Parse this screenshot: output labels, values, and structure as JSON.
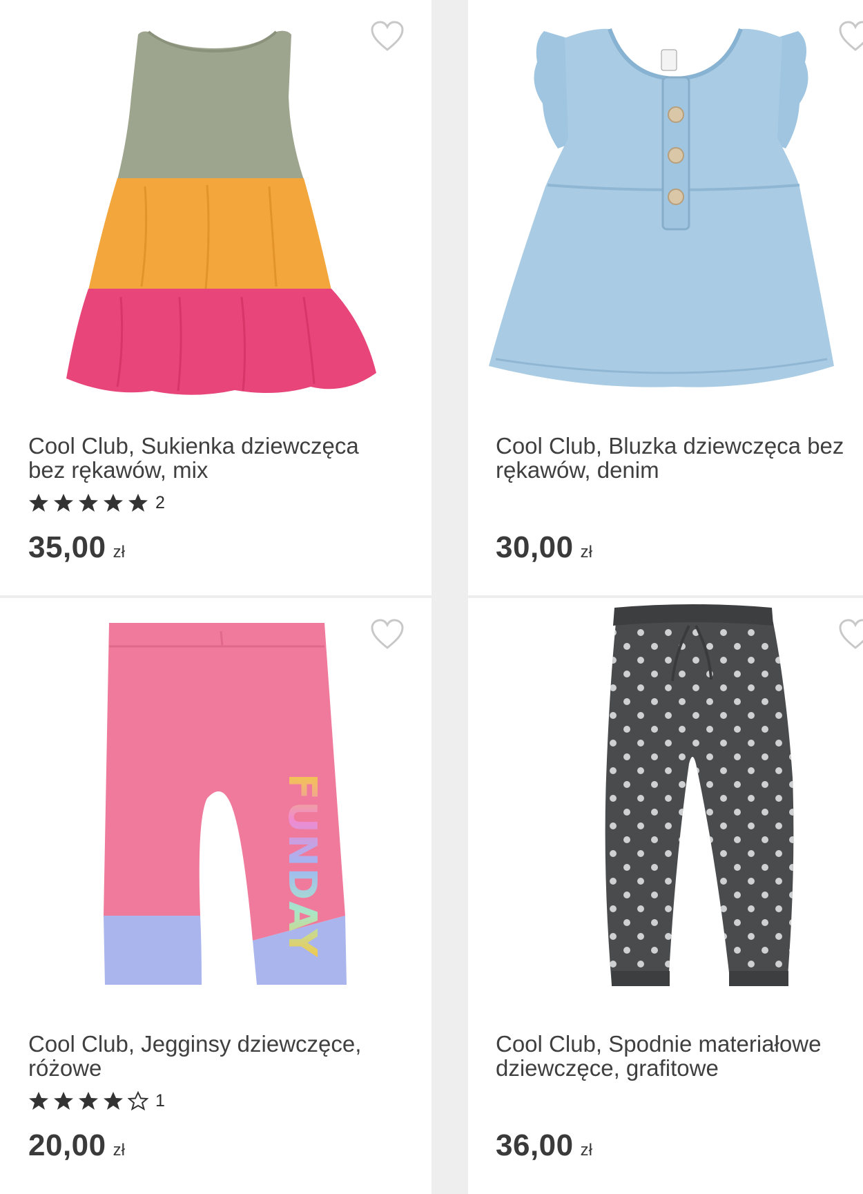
{
  "products": [
    {
      "title": "Cool Club, Sukienka dziewczęca bez rękawów, mix",
      "rating_stars": 5,
      "rating_count": "2",
      "price": "35,00",
      "currency": "zł",
      "image": "tiered-dress-green-orange-pink",
      "favorite_icon": "heart-outline-icon"
    },
    {
      "title": "Cool Club, Bluzka dziewczęca bez rękawów, denim",
      "rating_stars": 0,
      "rating_count": "",
      "price": "30,00",
      "currency": "zł",
      "image": "denim-ruffle-blouse",
      "favorite_icon": "heart-outline-icon"
    },
    {
      "title": "Cool Club, Jegginsy dziewczęce, różowe",
      "rating_stars": 4,
      "rating_count": "1",
      "price": "20,00",
      "currency": "zł",
      "image": "pink-leggings-funday",
      "favorite_icon": "heart-outline-icon"
    },
    {
      "title": "Cool Club, Spodnie materiałowe dziewczęce, grafitowe",
      "rating_stars": 0,
      "rating_count": "",
      "price": "36,00",
      "currency": "zł",
      "image": "graphite-polka-dot-trousers",
      "favorite_icon": "heart-outline-icon"
    }
  ],
  "leggings_print": "FUNDAY",
  "colors": {
    "text": "#3a3a3a",
    "star": "#333333",
    "heart": "#c8c8c8",
    "dress_green": "#9ea58e",
    "dress_orange": "#f3a63c",
    "dress_pink": "#e8457a",
    "denim": "#a9cce4",
    "leggings_pink": "#f07a9c",
    "leggings_lilac": "#a9b5ec",
    "trousers_graphite": "#4a4b4d"
  }
}
